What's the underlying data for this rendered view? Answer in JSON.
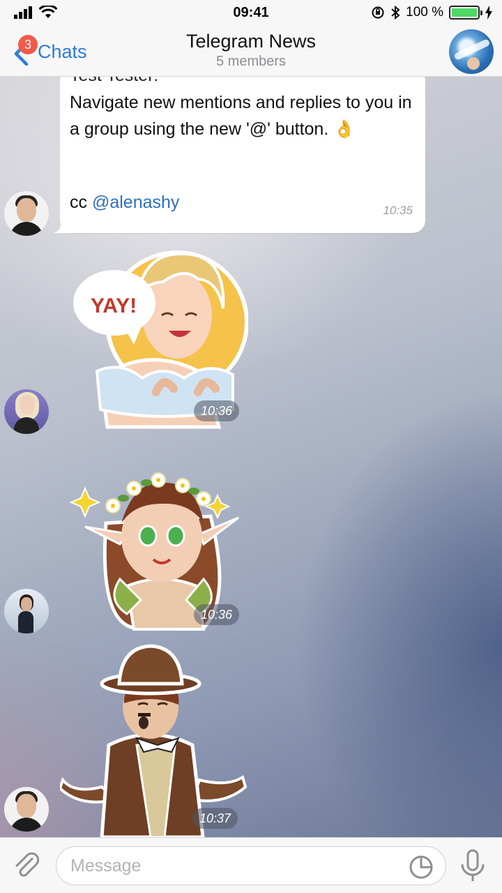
{
  "status_bar": {
    "time": "09:41",
    "battery_text": "100 %",
    "icons": [
      "signal-icon",
      "wifi-icon",
      "orientation-lock-icon",
      "bluetooth-icon",
      "battery-icon",
      "charging-icon"
    ],
    "battery_color": "#4cd964"
  },
  "nav": {
    "back_label": "Chats",
    "unread_badge": "3",
    "title": "Telegram News",
    "subtitle": "5 members",
    "accent_color": "#2d7cd6",
    "badge_color": "#f25a4a"
  },
  "messages": [
    {
      "type": "text",
      "sender": "Test Tester:",
      "text": "Navigate new mentions and replies to you in a group using the new '@' button. 👌",
      "cc_prefix": "cc ",
      "mention": "@alenashy",
      "time": "10:35"
    },
    {
      "type": "sticker",
      "sticker": "yay-girl-sticker",
      "bubble_text": "YAY!",
      "time": "10:36"
    },
    {
      "type": "sticker",
      "sticker": "forest-elf-sticker",
      "time": "10:36"
    },
    {
      "type": "sticker",
      "sticker": "bowler-hat-man-sticker",
      "time": "10:37"
    }
  ],
  "input": {
    "placeholder": "Message",
    "icons": [
      "paperclip-icon",
      "sticker-icon",
      "microphone-icon"
    ]
  }
}
